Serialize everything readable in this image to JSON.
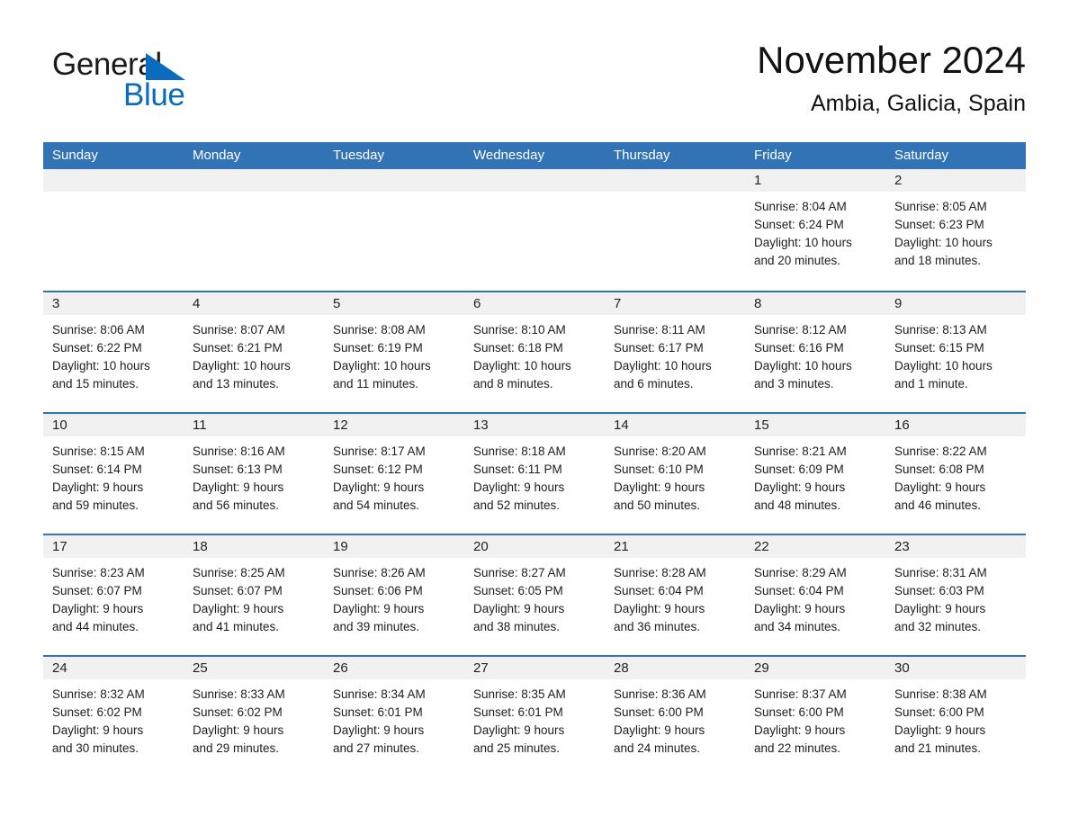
{
  "brand": {
    "name_part1": "General",
    "name_part2": "Blue",
    "triangle_color": "#0b6bbf",
    "text_color": "#1a1a1a"
  },
  "header": {
    "month_title": "November 2024",
    "location": "Ambia, Galicia, Spain"
  },
  "colors": {
    "header_blue": "#3273b5",
    "row_divider_blue": "#3273b5",
    "day_band_gray": "#f1f1f1",
    "text": "#1d1d1d"
  },
  "calendar": {
    "weekdays": [
      "Sunday",
      "Monday",
      "Tuesday",
      "Wednesday",
      "Thursday",
      "Friday",
      "Saturday"
    ],
    "weeks": [
      [
        {
          "day": "",
          "lines": []
        },
        {
          "day": "",
          "lines": []
        },
        {
          "day": "",
          "lines": []
        },
        {
          "day": "",
          "lines": []
        },
        {
          "day": "",
          "lines": []
        },
        {
          "day": "1",
          "lines": [
            "Sunrise: 8:04 AM",
            "Sunset: 6:24 PM",
            "Daylight: 10 hours",
            "and 20 minutes."
          ]
        },
        {
          "day": "2",
          "lines": [
            "Sunrise: 8:05 AM",
            "Sunset: 6:23 PM",
            "Daylight: 10 hours",
            "and 18 minutes."
          ]
        }
      ],
      [
        {
          "day": "3",
          "lines": [
            "Sunrise: 8:06 AM",
            "Sunset: 6:22 PM",
            "Daylight: 10 hours",
            "and 15 minutes."
          ]
        },
        {
          "day": "4",
          "lines": [
            "Sunrise: 8:07 AM",
            "Sunset: 6:21 PM",
            "Daylight: 10 hours",
            "and 13 minutes."
          ]
        },
        {
          "day": "5",
          "lines": [
            "Sunrise: 8:08 AM",
            "Sunset: 6:19 PM",
            "Daylight: 10 hours",
            "and 11 minutes."
          ]
        },
        {
          "day": "6",
          "lines": [
            "Sunrise: 8:10 AM",
            "Sunset: 6:18 PM",
            "Daylight: 10 hours",
            "and 8 minutes."
          ]
        },
        {
          "day": "7",
          "lines": [
            "Sunrise: 8:11 AM",
            "Sunset: 6:17 PM",
            "Daylight: 10 hours",
            "and 6 minutes."
          ]
        },
        {
          "day": "8",
          "lines": [
            "Sunrise: 8:12 AM",
            "Sunset: 6:16 PM",
            "Daylight: 10 hours",
            "and 3 minutes."
          ]
        },
        {
          "day": "9",
          "lines": [
            "Sunrise: 8:13 AM",
            "Sunset: 6:15 PM",
            "Daylight: 10 hours",
            "and 1 minute."
          ]
        }
      ],
      [
        {
          "day": "10",
          "lines": [
            "Sunrise: 8:15 AM",
            "Sunset: 6:14 PM",
            "Daylight: 9 hours",
            "and 59 minutes."
          ]
        },
        {
          "day": "11",
          "lines": [
            "Sunrise: 8:16 AM",
            "Sunset: 6:13 PM",
            "Daylight: 9 hours",
            "and 56 minutes."
          ]
        },
        {
          "day": "12",
          "lines": [
            "Sunrise: 8:17 AM",
            "Sunset: 6:12 PM",
            "Daylight: 9 hours",
            "and 54 minutes."
          ]
        },
        {
          "day": "13",
          "lines": [
            "Sunrise: 8:18 AM",
            "Sunset: 6:11 PM",
            "Daylight: 9 hours",
            "and 52 minutes."
          ]
        },
        {
          "day": "14",
          "lines": [
            "Sunrise: 8:20 AM",
            "Sunset: 6:10 PM",
            "Daylight: 9 hours",
            "and 50 minutes."
          ]
        },
        {
          "day": "15",
          "lines": [
            "Sunrise: 8:21 AM",
            "Sunset: 6:09 PM",
            "Daylight: 9 hours",
            "and 48 minutes."
          ]
        },
        {
          "day": "16",
          "lines": [
            "Sunrise: 8:22 AM",
            "Sunset: 6:08 PM",
            "Daylight: 9 hours",
            "and 46 minutes."
          ]
        }
      ],
      [
        {
          "day": "17",
          "lines": [
            "Sunrise: 8:23 AM",
            "Sunset: 6:07 PM",
            "Daylight: 9 hours",
            "and 44 minutes."
          ]
        },
        {
          "day": "18",
          "lines": [
            "Sunrise: 8:25 AM",
            "Sunset: 6:07 PM",
            "Daylight: 9 hours",
            "and 41 minutes."
          ]
        },
        {
          "day": "19",
          "lines": [
            "Sunrise: 8:26 AM",
            "Sunset: 6:06 PM",
            "Daylight: 9 hours",
            "and 39 minutes."
          ]
        },
        {
          "day": "20",
          "lines": [
            "Sunrise: 8:27 AM",
            "Sunset: 6:05 PM",
            "Daylight: 9 hours",
            "and 38 minutes."
          ]
        },
        {
          "day": "21",
          "lines": [
            "Sunrise: 8:28 AM",
            "Sunset: 6:04 PM",
            "Daylight: 9 hours",
            "and 36 minutes."
          ]
        },
        {
          "day": "22",
          "lines": [
            "Sunrise: 8:29 AM",
            "Sunset: 6:04 PM",
            "Daylight: 9 hours",
            "and 34 minutes."
          ]
        },
        {
          "day": "23",
          "lines": [
            "Sunrise: 8:31 AM",
            "Sunset: 6:03 PM",
            "Daylight: 9 hours",
            "and 32 minutes."
          ]
        }
      ],
      [
        {
          "day": "24",
          "lines": [
            "Sunrise: 8:32 AM",
            "Sunset: 6:02 PM",
            "Daylight: 9 hours",
            "and 30 minutes."
          ]
        },
        {
          "day": "25",
          "lines": [
            "Sunrise: 8:33 AM",
            "Sunset: 6:02 PM",
            "Daylight: 9 hours",
            "and 29 minutes."
          ]
        },
        {
          "day": "26",
          "lines": [
            "Sunrise: 8:34 AM",
            "Sunset: 6:01 PM",
            "Daylight: 9 hours",
            "and 27 minutes."
          ]
        },
        {
          "day": "27",
          "lines": [
            "Sunrise: 8:35 AM",
            "Sunset: 6:01 PM",
            "Daylight: 9 hours",
            "and 25 minutes."
          ]
        },
        {
          "day": "28",
          "lines": [
            "Sunrise: 8:36 AM",
            "Sunset: 6:00 PM",
            "Daylight: 9 hours",
            "and 24 minutes."
          ]
        },
        {
          "day": "29",
          "lines": [
            "Sunrise: 8:37 AM",
            "Sunset: 6:00 PM",
            "Daylight: 9 hours",
            "and 22 minutes."
          ]
        },
        {
          "day": "30",
          "lines": [
            "Sunrise: 8:38 AM",
            "Sunset: 6:00 PM",
            "Daylight: 9 hours",
            "and 21 minutes."
          ]
        }
      ]
    ]
  }
}
